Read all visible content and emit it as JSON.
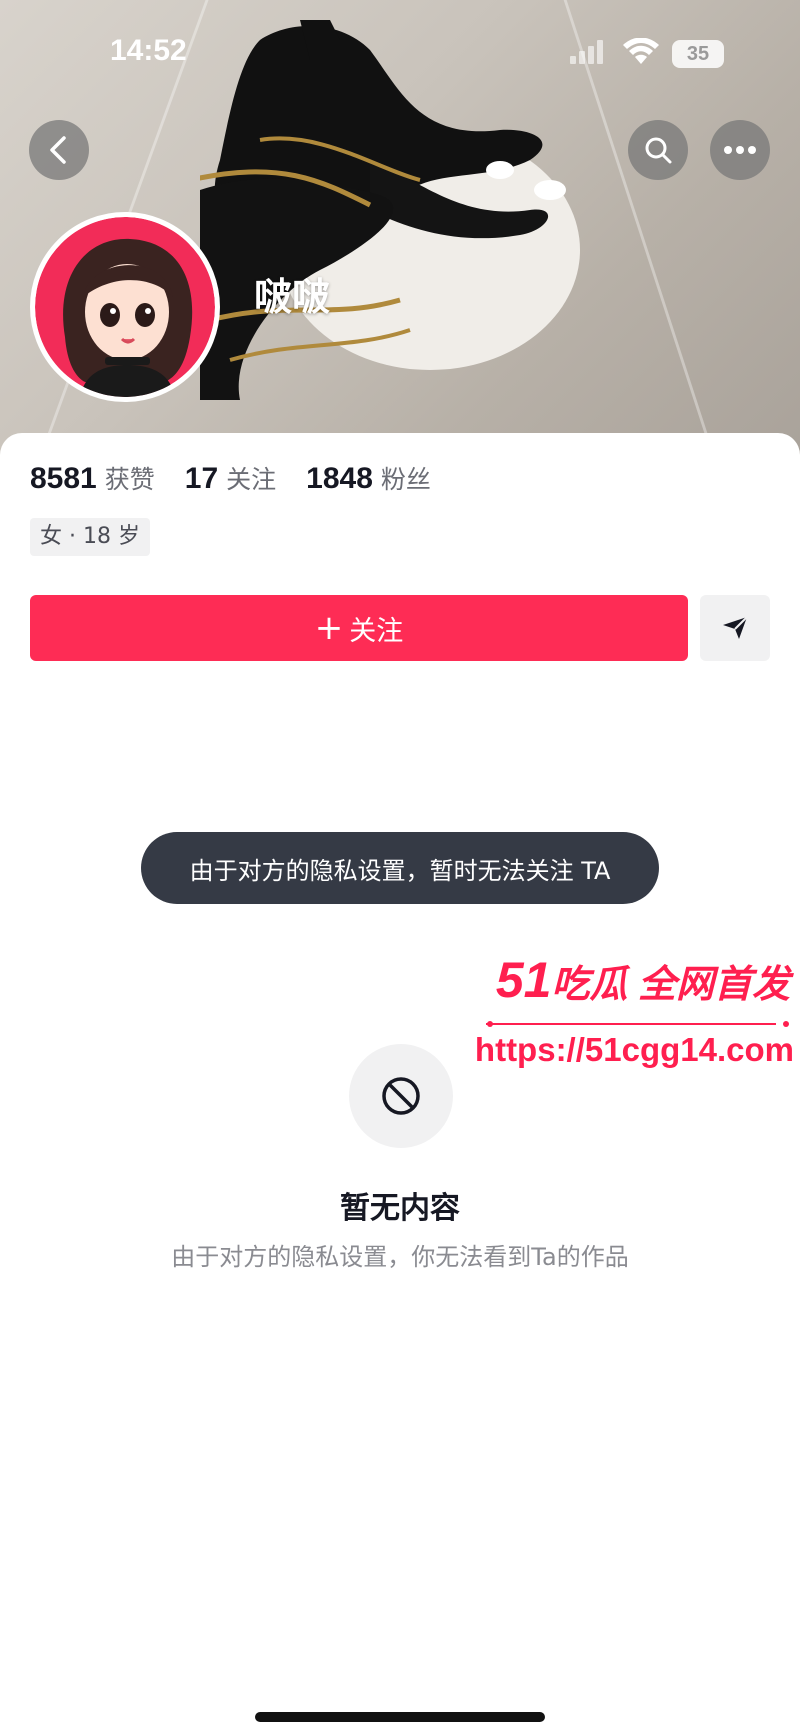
{
  "status_bar": {
    "time": "14:52",
    "battery": "35"
  },
  "header": {
    "nickname": "啵啵"
  },
  "stats": [
    {
      "value": "8581",
      "label": "获赞"
    },
    {
      "value": "17",
      "label": "关注"
    },
    {
      "value": "1848",
      "label": "粉丝"
    }
  ],
  "profile": {
    "tag": "女 · 18 岁"
  },
  "actions": {
    "follow_plus": "+",
    "follow_label": "关注"
  },
  "toast": {
    "text": "由于对方的隐私设置，暂时无法关注 TA"
  },
  "watermark": {
    "prefix": "51",
    "title": "吃瓜 全网首发",
    "url": "https://51cgg14.com"
  },
  "empty_state": {
    "title": "暂无内容",
    "description": "由于对方的隐私设置，你无法看到Ta的作品"
  },
  "colors": {
    "accent": "#fe2c55",
    "toast_bg": "#353a45",
    "watermark": "#ff1f4f"
  }
}
